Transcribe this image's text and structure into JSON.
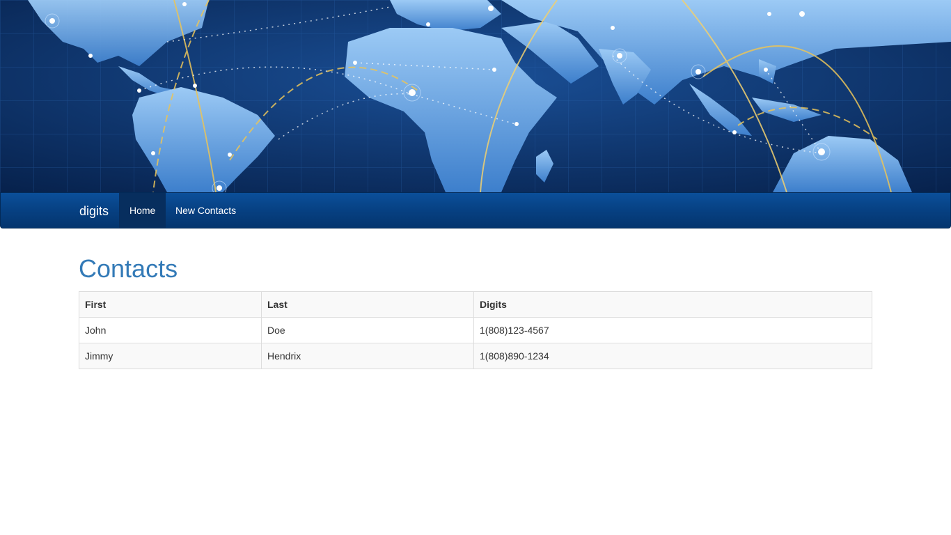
{
  "banner": {
    "image": "world-map-network-banner"
  },
  "navbar": {
    "brand": "digits",
    "items": [
      {
        "label": "Home",
        "active": true
      },
      {
        "label": "New Contacts",
        "active": false
      }
    ]
  },
  "page": {
    "title": "Contacts"
  },
  "table": {
    "headers": [
      "First",
      "Last",
      "Digits"
    ],
    "rows": [
      [
        "John",
        "Doe",
        "1(808)123-4567"
      ],
      [
        "Jimmy",
        "Hendrix",
        "1(808)890-1234"
      ]
    ]
  },
  "colors": {
    "navbar": "#063f80",
    "title": "#337ab7",
    "map_ocean": "#0b2a5c",
    "map_land": "#4d8fd6"
  }
}
